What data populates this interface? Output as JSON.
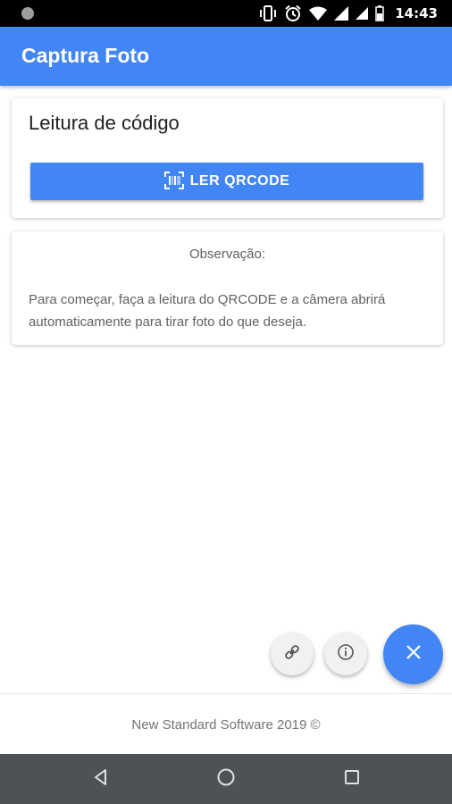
{
  "status_bar": {
    "time": "14:43",
    "icons": [
      "notification-dot-icon",
      "vibrate-icon",
      "alarm-icon",
      "wifi-icon",
      "signal-icon",
      "signal-icon",
      "battery-icon"
    ]
  },
  "app_bar": {
    "title": "Captura Foto"
  },
  "scan_card": {
    "title": "Leitura de código",
    "button_label": "LER QRCODE",
    "button_icon": "barcode-scan-icon"
  },
  "note_card": {
    "title": "Observação:",
    "text": "Para começar, faça a leitura do QRCODE e a câmera abrirá automaticamente para tirar foto do que deseja."
  },
  "fab": {
    "link_icon": "link-icon",
    "info_icon": "info-icon",
    "close_icon": "close-icon"
  },
  "footer": {
    "text": "New Standard Software 2019 ©"
  },
  "nav_bar": {
    "icons": [
      "back-icon",
      "home-icon",
      "recents-icon"
    ]
  },
  "colors": {
    "primary": "#4285f4",
    "status_bar": "#000000",
    "nav_bar": "#4d5256",
    "text_dark": "#212121",
    "text_muted": "#616161"
  }
}
